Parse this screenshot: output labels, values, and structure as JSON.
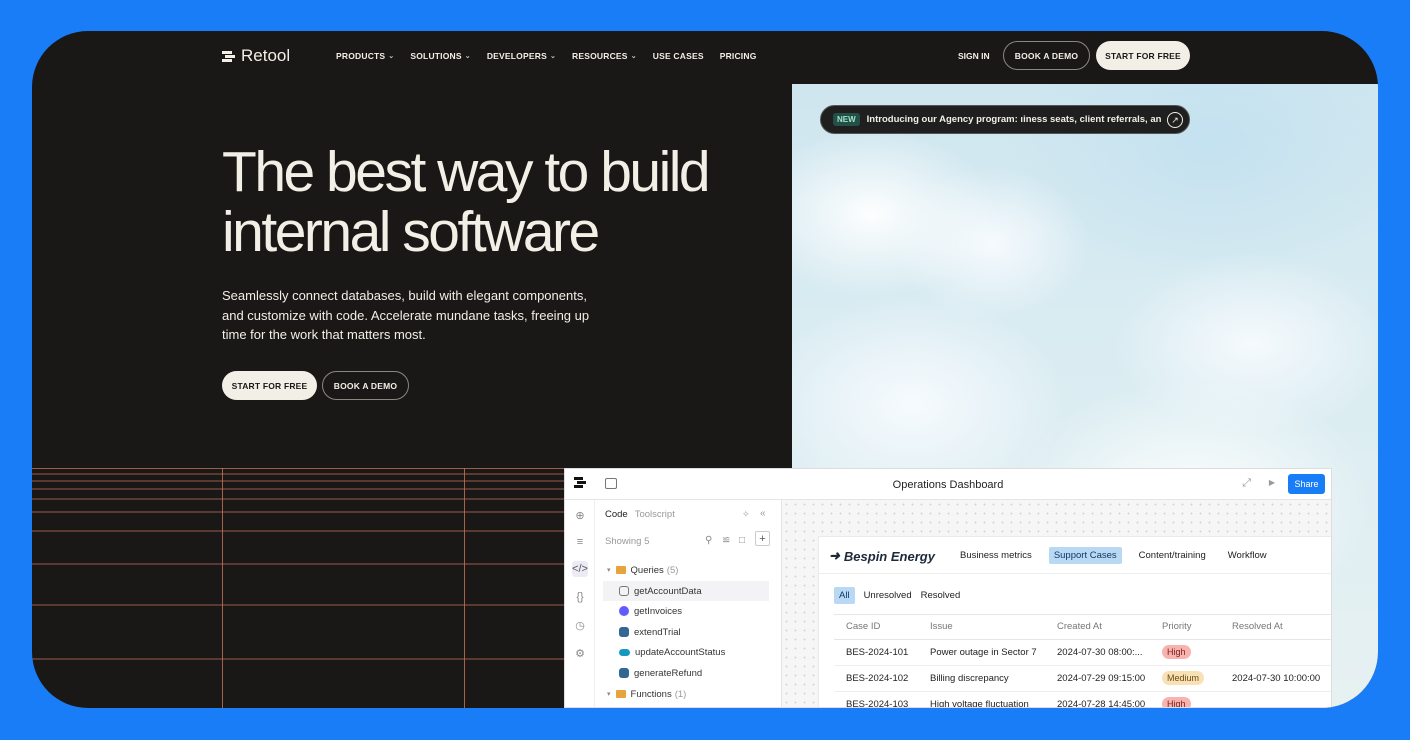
{
  "brand": {
    "name": "Retool"
  },
  "nav": {
    "links": [
      {
        "label": "PRODUCTS",
        "caret": true
      },
      {
        "label": "SOLUTIONS",
        "caret": true
      },
      {
        "label": "DEVELOPERS",
        "caret": true
      },
      {
        "label": "RESOURCES",
        "caret": true
      },
      {
        "label": "USE CASES",
        "caret": false
      },
      {
        "label": "PRICING",
        "caret": false
      }
    ],
    "sign_in": "SIGN IN",
    "book_demo": "BOOK A DEMO",
    "start_free": "START FOR FREE"
  },
  "hero": {
    "title_line1": "The best way to build",
    "title_line2": "internal software",
    "subtitle": "Seamlessly connect databases, build with elegant components, and customize with code. Accelerate mundane tasks, freeing up time for the work that matters most.",
    "cta_primary": "START FOR FREE",
    "cta_secondary": "BOOK A DEMO"
  },
  "announcement": {
    "badge": "NEW",
    "text": "Introducing our Agency program: ıiness seats, client referrals, an"
  },
  "app": {
    "title": "Operations Dashboard",
    "share": "Share",
    "code_panel": {
      "tab_code": "Code",
      "tab_toolscript": "Toolscript",
      "showing": "Showing 5",
      "queries_label": "Queries",
      "queries_count": "(5)",
      "queries": [
        {
          "name": "getAccountData",
          "icon": "database-icon",
          "color": "#666666"
        },
        {
          "name": "getInvoices",
          "icon": "stripe-icon",
          "color": "#635bff"
        },
        {
          "name": "extendTrial",
          "icon": "postgres-icon",
          "color": "#336791"
        },
        {
          "name": "updateAccountStatus",
          "icon": "salesforce-icon",
          "color": "#1798c1"
        },
        {
          "name": "generateRefund",
          "icon": "postgres-icon",
          "color": "#336791"
        }
      ],
      "functions_label": "Functions",
      "functions_count": "(1)"
    },
    "dashboard": {
      "company": "Bespin Energy",
      "tabs": [
        "Business metrics",
        "Support Cases",
        "Content/training",
        "Workflow"
      ],
      "active_tab": "Support Cases",
      "filters": [
        "All",
        "Unresolved",
        "Resolved"
      ],
      "active_filter": "All",
      "columns": [
        "Case ID",
        "Issue",
        "Created At",
        "Priority",
        "Resolved At"
      ],
      "rows": [
        {
          "id": "BES-2024-101",
          "issue": "Power outage in Sector 7",
          "created": "2024-07-30 08:00:...",
          "priority": "High",
          "resolved": ""
        },
        {
          "id": "BES-2024-102",
          "issue": "Billing discrepancy",
          "created": "2024-07-29 09:15:00",
          "priority": "Medium",
          "resolved": "2024-07-30 10:00:00"
        },
        {
          "id": "BES-2024-103",
          "issue": "High voltage fluctuation",
          "created": "2024-07-28 14:45:00",
          "priority": "High",
          "resolved": ""
        }
      ]
    }
  },
  "colors": {
    "background": "#1a7df8",
    "dark": "#1a1717",
    "cream": "#f2efe6",
    "grid_line": "#c7775a",
    "share_blue": "#1a7df8"
  }
}
